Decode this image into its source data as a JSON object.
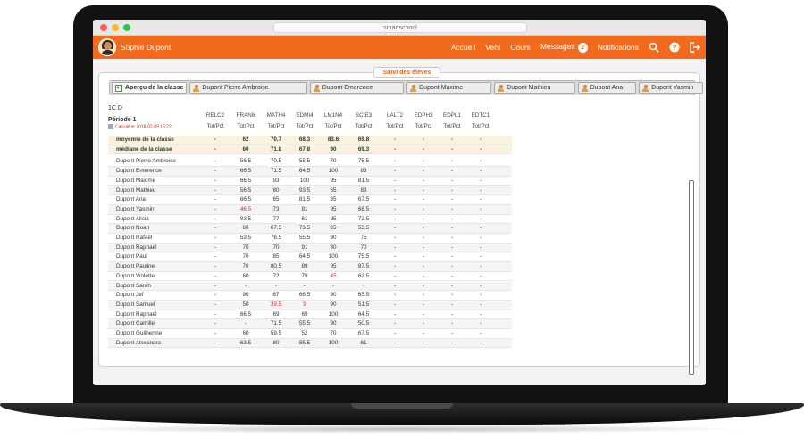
{
  "window": {
    "url": "smartschool"
  },
  "navbar": {
    "user_name": "Sophie Dupont",
    "links": [
      "Accueil",
      "Vers",
      "Cours",
      "Messages",
      "Notifications"
    ],
    "messages_badge": "2",
    "accent_color": "#f26a1b"
  },
  "section_button": "Suivi des élèves",
  "tabs": [
    "Aperçu de la classe",
    "Dupont Pierre Ambroise",
    "Dupont Emerence",
    "Dupont Maxime",
    "Dupont Mathieu",
    "Dupont Ana",
    "Dupont Yasmin"
  ],
  "class_name": "1C D",
  "period": "Période 1",
  "calc_note": "Calculé le 2018-02-09 15:22.",
  "columns": [
    {
      "code": "RELC2",
      "sub": "Tot/Pct"
    },
    {
      "code": "FRAN6",
      "sub": "Tot/Pct"
    },
    {
      "code": "MATH4",
      "sub": "Tot/Pct"
    },
    {
      "code": "EDMI4",
      "sub": "Tot/Pct"
    },
    {
      "code": "LM1N4",
      "sub": "Tot/Pct"
    },
    {
      "code": "SCIE3",
      "sub": "Tot/Pct"
    },
    {
      "code": "LALT2",
      "sub": "Tot/Pct"
    },
    {
      "code": "EDPH3",
      "sub": "Tot/Pct"
    },
    {
      "code": "EDPL1",
      "sub": "Tot/Pct"
    },
    {
      "code": "EDTC1",
      "sub": "Tot/Pct"
    }
  ],
  "stats": [
    {
      "label": "moyenne de la classe",
      "values": [
        "-",
        "62",
        "70.7",
        "68.3",
        "83.6",
        "69.8",
        "-",
        "-",
        "-",
        "-"
      ]
    },
    {
      "label": "médiane de la classe",
      "values": [
        "-",
        "60",
        "71.8",
        "67.8",
        "90",
        "69.3",
        "-",
        "-",
        "-",
        "-"
      ]
    }
  ],
  "students": [
    {
      "name": "Dupont Pierre Ambroise",
      "values": [
        "-",
        "56.5",
        "70.5",
        "55.5",
        "70",
        "75.5",
        "-",
        "-",
        "-",
        "-"
      ]
    },
    {
      "name": "Dupont Emerence",
      "values": [
        "-",
        "66.5",
        "71.5",
        "64.5",
        "100",
        "83",
        "-",
        "-",
        "-",
        "-"
      ]
    },
    {
      "name": "Dupont Maxime",
      "values": [
        "-",
        "66.5",
        "93",
        "100",
        "95",
        "81.5",
        "-",
        "-",
        "-",
        "-"
      ]
    },
    {
      "name": "Dupont Mathieu",
      "values": [
        "-",
        "56.5",
        "80",
        "93.5",
        "65",
        "83",
        "-",
        "-",
        "-",
        "-"
      ]
    },
    {
      "name": "Dupont Ana",
      "values": [
        "-",
        "66.5",
        "65",
        "81.5",
        "85",
        "67.5",
        "-",
        "-",
        "-",
        "-"
      ]
    },
    {
      "name": "Dupont Yasmin",
      "values": [
        "-",
        "46.5",
        "73",
        "81",
        "95",
        "68.5",
        "-",
        "-",
        "-",
        "-"
      ],
      "red": [
        1
      ]
    },
    {
      "name": "Dupont Alicia",
      "values": [
        "-",
        "83.5",
        "77",
        "61",
        "95",
        "72.5",
        "-",
        "-",
        "-",
        "-"
      ]
    },
    {
      "name": "Dupont Noah",
      "values": [
        "-",
        "60",
        "67.5",
        "73.5",
        "85",
        "55.5",
        "-",
        "-",
        "-",
        "-"
      ]
    },
    {
      "name": "Dupont Rafael",
      "values": [
        "-",
        "53.5",
        "76.5",
        "55.5",
        "90",
        "75",
        "-",
        "-",
        "-",
        "-"
      ]
    },
    {
      "name": "Dupont Raphael",
      "values": [
        "-",
        "70",
        "70",
        "91",
        "80",
        "70",
        "-",
        "-",
        "-",
        "-"
      ]
    },
    {
      "name": "Dupont Paul",
      "values": [
        "-",
        "70",
        "85",
        "64.5",
        "100",
        "75.5",
        "-",
        "-",
        "-",
        "-"
      ]
    },
    {
      "name": "Dupont Pauline",
      "values": [
        "-",
        "70",
        "80.5",
        "89",
        "95",
        "87.5",
        "-",
        "-",
        "-",
        "-"
      ]
    },
    {
      "name": "Dupont Violette",
      "values": [
        "-",
        "60",
        "72",
        "79",
        "45",
        "62.5",
        "-",
        "-",
        "-",
        "-"
      ],
      "red": [
        4
      ]
    },
    {
      "name": "Dupont Sarah",
      "values": [
        "-",
        "-",
        "-",
        "-",
        "-",
        "-",
        "-",
        "-",
        "-",
        "-"
      ],
      "red": [
        4
      ]
    },
    {
      "name": "Dupont Jef",
      "values": [
        "-",
        "90",
        "67",
        "66.5",
        "90",
        "65.5",
        "-",
        "-",
        "-",
        "-"
      ]
    },
    {
      "name": "Dupont Samuel",
      "values": [
        "-",
        "50",
        "39.5",
        "9",
        "90",
        "51.5",
        "-",
        "-",
        "-",
        "-"
      ],
      "red": [
        2,
        3
      ]
    },
    {
      "name": "Dupont Raphael",
      "values": [
        "-",
        "66.5",
        "69",
        "69",
        "100",
        "64.5",
        "-",
        "-",
        "-",
        "-"
      ]
    },
    {
      "name": "Dupont Camille",
      "values": [
        "-",
        "-",
        "71.5",
        "55.5",
        "90",
        "50.5",
        "-",
        "-",
        "-",
        "-"
      ]
    },
    {
      "name": "Dupont Guilherme",
      "values": [
        "-",
        "60",
        "59.5",
        "52",
        "70",
        "67.5",
        "-",
        "-",
        "-",
        "-"
      ]
    },
    {
      "name": "Dupont Alexandra",
      "values": [
        "-",
        "63.5",
        "80",
        "85.5",
        "100",
        "61",
        "-",
        "-",
        "-",
        "-"
      ]
    }
  ]
}
